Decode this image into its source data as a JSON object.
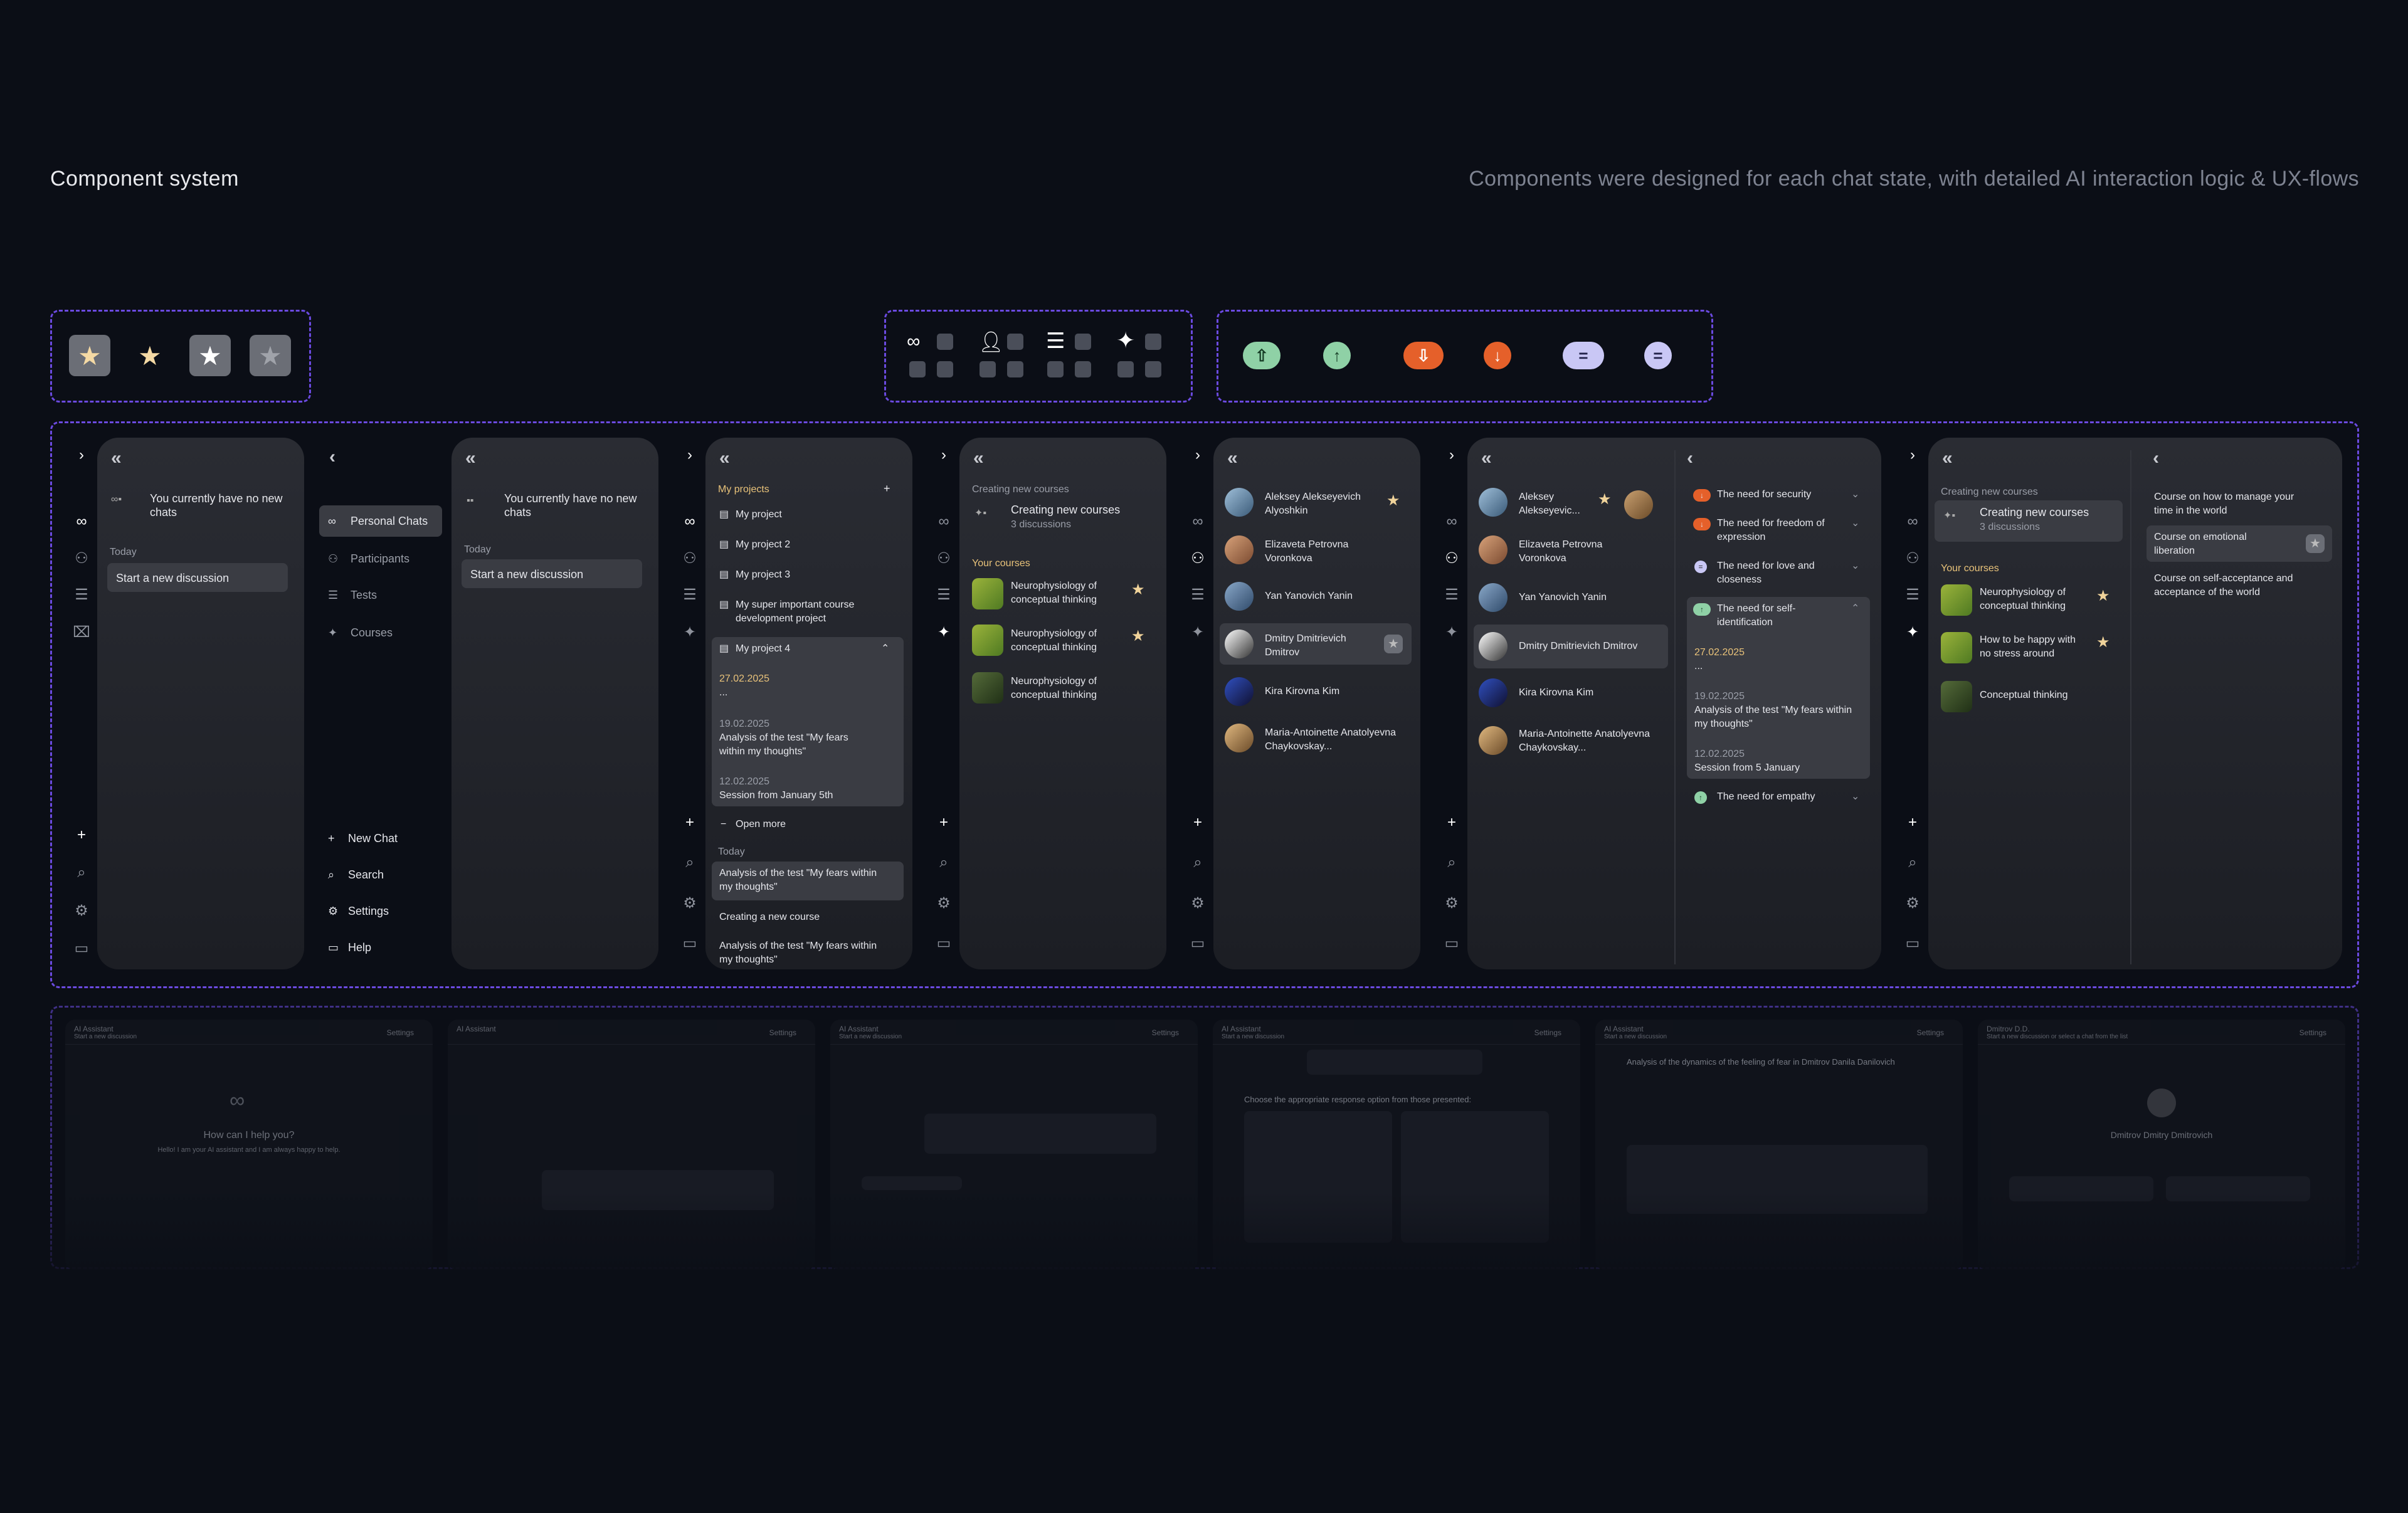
{
  "header": {
    "title": "Component system",
    "subtitle": "Components were designed for each chat state, with detailed AI interaction logic & UX-flows"
  },
  "colors": {
    "accent": "#6b4ae0",
    "background": "#0b0e16",
    "panel": "#25272d",
    "gold": "#f0d39a",
    "orange": "#e5602a",
    "green": "#8fd1a6",
    "lavender": "#c9c7f5"
  },
  "panel1": {
    "empty_title": "You currently have no new chats",
    "today": "Today",
    "start": "Start a new discussion"
  },
  "panel2": {
    "items": [
      "Personal Chats",
      "Participants",
      "Tests",
      "Courses"
    ],
    "bottom": [
      "New Chat",
      "Search",
      "Settings",
      "Help"
    ]
  },
  "panel3": {
    "empty_title": "You currently have no new chats",
    "today": "Today",
    "start": "Start a new discussion"
  },
  "panel4": {
    "projects_label": "My projects",
    "projects": [
      "My project",
      "My project 2",
      "My project 3",
      "My super important course development project",
      "My project 4"
    ],
    "sessions": [
      {
        "date": "27.02.2025",
        "text": "..."
      },
      {
        "date": "19.02.2025",
        "text": "Analysis of the test \"My fears within my thoughts\""
      },
      {
        "date": "12.02.2025",
        "text": "Session from January 5th"
      }
    ],
    "open_more": "Open more",
    "today": "Today",
    "today_items": [
      "Analysis of the test \"My fears within my thoughts\"",
      "Creating a new course",
      "Analysis of the test \"My fears within my thoughts\""
    ]
  },
  "panel5": {
    "section_top": "Creating new courses",
    "card_title": "Creating new courses",
    "card_sub": "3 discussions",
    "your_courses": "Your courses",
    "courses": [
      "Neurophysiology of conceptual thinking",
      "Neurophysiology of conceptual thinking",
      "Neurophysiology of conceptual thinking"
    ]
  },
  "panel6": {
    "people": [
      "Aleksey Alekseyevich Alyoshkin",
      "Elizaveta Petrovna Voronkova",
      "Yan Yanovich Yanin",
      "Dmitry Dmitrievich Dmitrov",
      "Kira Kirovna Kim",
      "Maria-Antoinette Anatolyevna Chaykovskay..."
    ]
  },
  "panel7": {
    "people": [
      "Aleksey Alekseyevic...",
      "Elizaveta Petrovna Voronkova",
      "Yan Yanovich Yanin",
      "Dmitry Dmitrievich Dmitrov",
      "Kira Kirovna Kim",
      "Maria-Antoinette Anatolyevna Chaykovskay..."
    ],
    "needs": [
      "The need for security",
      "The need for freedom of expression",
      "The need for love and closeness",
      "The need for self-identification",
      "The need for empathy"
    ],
    "sessions": [
      {
        "date": "27.02.2025",
        "text": "..."
      },
      {
        "date": "19.02.2025",
        "text": "Analysis of the test \"My fears within my thoughts\""
      },
      {
        "date": "12.02.2025",
        "text": "Session from 5 January"
      }
    ]
  },
  "panel8": {
    "section_top": "Creating new courses",
    "card_title": "Creating new courses",
    "card_sub": "3 discussions",
    "your_courses": "Your courses",
    "courses": [
      "Neurophysiology of conceptual thinking",
      "How to be happy with no stress around",
      "Conceptual thinking"
    ],
    "right_items": [
      "Course on how to manage your time in the world",
      "Course on emotional liberation",
      "Course on self-acceptance and acceptance of the world"
    ]
  },
  "previews": [
    {
      "title": "AI Assistant",
      "sub": "Start a new discussion",
      "settings": "Settings",
      "center": "How can I help you?",
      "center_sub": "Hello! I am your AI assistant and I am always happy to help."
    },
    {
      "title": "AI Assistant",
      "sub": "",
      "settings": "Settings",
      "center": "",
      "center_sub": ""
    },
    {
      "title": "AI Assistant",
      "sub": "Start a new discussion",
      "settings": "Settings",
      "center": "",
      "center_sub": ""
    },
    {
      "title": "AI Assistant",
      "sub": "Start a new discussion",
      "settings": "Settings",
      "center": "Choose the appropriate response option from those presented:",
      "center_sub": ""
    },
    {
      "title": "AI Assistant",
      "sub": "Start a new discussion",
      "settings": "Settings",
      "center": "Analysis of the dynamics of the feeling of fear in Dmitrov Danila Danilovich",
      "center_sub": ""
    },
    {
      "title": "Dmitrov D.D.",
      "sub": "Start a new discussion or select a chat from the list",
      "settings": "Settings",
      "center": "Dmitrov Dmitry Dmitrovich",
      "center_sub": ""
    }
  ]
}
